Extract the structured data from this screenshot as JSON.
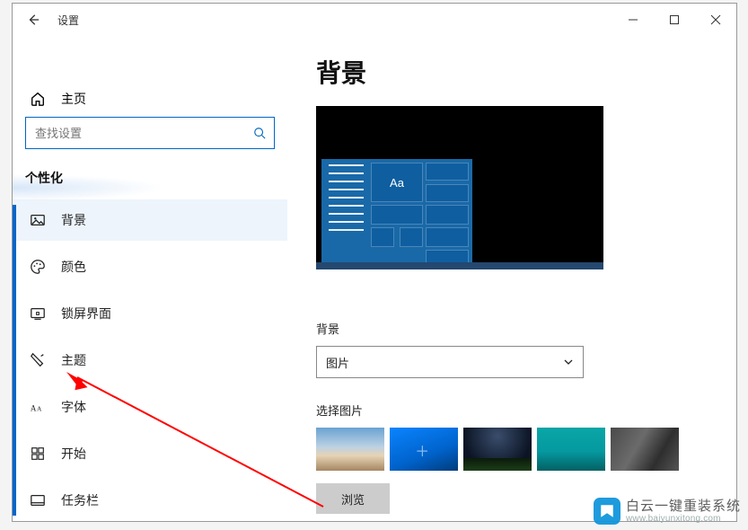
{
  "app_title": "设置",
  "home_label": "主页",
  "search_placeholder": "查找设置",
  "section_title": "个性化",
  "nav_items": [
    {
      "key": "background",
      "label": "背景",
      "selected": true
    },
    {
      "key": "colors",
      "label": "颜色"
    },
    {
      "key": "lockscreen",
      "label": "锁屏界面"
    },
    {
      "key": "themes",
      "label": "主题"
    },
    {
      "key": "fonts",
      "label": "字体"
    },
    {
      "key": "start",
      "label": "开始"
    },
    {
      "key": "taskbar",
      "label": "任务栏"
    }
  ],
  "page_title": "背景",
  "preview_tile_sample": "Aa",
  "bg_section": {
    "label": "背景",
    "dropdown_value": "图片"
  },
  "choose_label": "选择图片",
  "browse_label": "浏览",
  "watermark": {
    "main": "白云一键重装系统",
    "sub": "www.baiyunxitong.com"
  }
}
